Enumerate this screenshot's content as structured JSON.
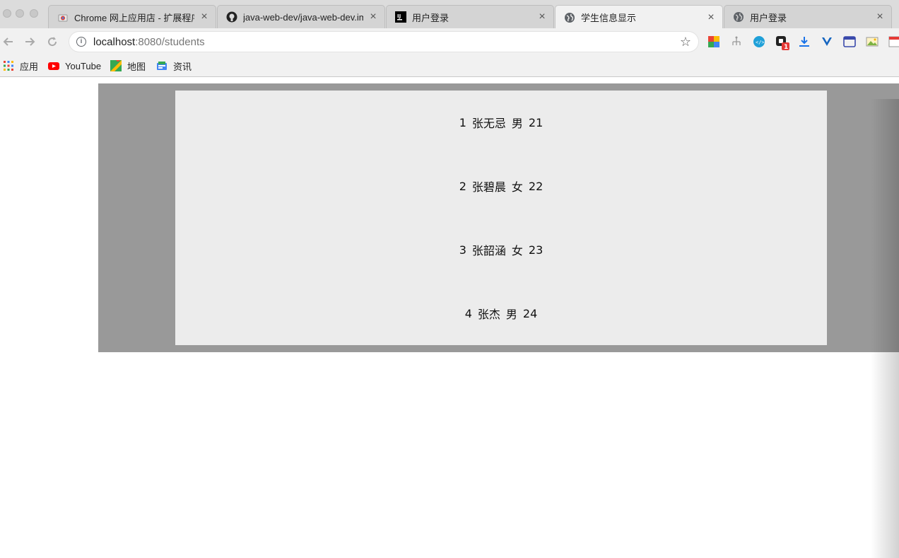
{
  "tabs": [
    {
      "title": "Chrome 网上应用店 - 扩展程序",
      "icon": "chrome-webstore-icon",
      "close": "×"
    },
    {
      "title": "java-web-dev/java-web-dev.im",
      "icon": "github-icon",
      "close": "×"
    },
    {
      "title": "用户登录",
      "icon": "intellij-icon",
      "close": "×"
    },
    {
      "title": "学生信息显示",
      "icon": "globe-icon",
      "close": "×"
    },
    {
      "title": "用户登录",
      "icon": "globe-icon",
      "close": "×"
    }
  ],
  "toolbar": {
    "url_host": "localhost",
    "url_rest": ":8080/students"
  },
  "bookmarks": [
    {
      "label": "应用",
      "icon": "apps-grid-icon"
    },
    {
      "label": "YouTube",
      "icon": "youtube-icon"
    },
    {
      "label": "地图",
      "icon": "maps-icon"
    },
    {
      "label": "资讯",
      "icon": "news-icon"
    }
  ],
  "extension_badge": "1",
  "students": [
    {
      "id": "1",
      "name": "张无忌",
      "gender": "男",
      "age": "21"
    },
    {
      "id": "2",
      "name": "张碧晨",
      "gender": "女",
      "age": "22"
    },
    {
      "id": "3",
      "name": "张韶涵",
      "gender": "女",
      "age": "23"
    },
    {
      "id": "4",
      "name": "张杰",
      "gender": "男",
      "age": "24"
    }
  ],
  "colors": {
    "outer_box": "#999999",
    "inner_box": "#ececec"
  }
}
